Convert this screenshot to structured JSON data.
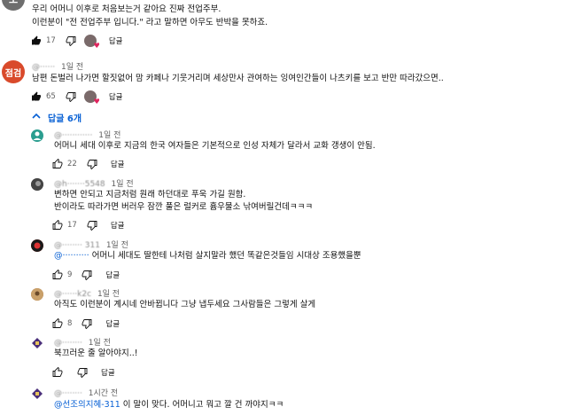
{
  "comments": [
    {
      "avatar_text": "모",
      "avatar_color": "#6e6e6e",
      "lines": [
        "우리 어머니 이후로 처음보는거 같아요 진짜 전업주부.",
        "이런분이 \"전 전업주부 입니다.\" 라고 말하면 아무도 반박을 못하죠."
      ],
      "likes": "17",
      "reply_label": "답글"
    },
    {
      "avatar_text": "점검",
      "avatar_color": "#d94a2b",
      "author": "@······",
      "time": "1일 전",
      "lines": [
        "남편 돈벌러 나가면 할짓없어 맘 카페나 기웃거리며 세상만사 관여하는 잉여인간들이 나츠키를 보고 반만 따라갔으면.."
      ],
      "likes": "65",
      "reply_label": "답글"
    }
  ],
  "replies_toggle": {
    "label": "답글 6개",
    "arrow": "^"
  },
  "replies": [
    {
      "avatar_color": "#2a9d8f",
      "author": "@············",
      "time": "1일 전",
      "lines": [
        "어머니 세대 이후로 지금의 한국 여자들은 기본적으로 인성 자체가 달라서 교화 갱생이 안됨."
      ],
      "likes": "22",
      "reply_label": "답글"
    },
    {
      "avatar_color": "#555555",
      "author": "@h·······5548",
      "time": "1일 전",
      "lines": [
        "변하면 안되고 지금처럼 원래 하던대로 푸욱 가길 원함.",
        "반이라도 따라가면 버러우 잠깐 풀은 럴커로 흄우물소 낚여버릴건데ㅋㅋㅋ"
      ],
      "likes": "17",
      "reply_label": "답글"
    },
    {
      "avatar_color": "#c0392b",
      "author": "@········ 311",
      "time": "1일 전",
      "mention": "@·········· ",
      "lines": [
        "어머니 세대도 딸한테 나처럼 살지말라 했던 똑같은것들임 시대상 조용했을뿐"
      ],
      "likes": "9",
      "reply_label": "답글"
    },
    {
      "avatar_color": "#b07a4a",
      "author": "@······k2c",
      "time": "1일 전",
      "lines": [
        "아직도 이런분이 계시네 안바뀝니다 그냥 냅두세요 그사람들은 그렇게 살게"
      ],
      "likes": "8",
      "reply_label": "답글"
    },
    {
      "avatar_color": "#4a2f7a",
      "author": "@········",
      "time": "1일 전",
      "lines": [
        "북끄러운 줄 알아야지..!"
      ],
      "likes": "",
      "reply_label": "답글"
    },
    {
      "avatar_color": "#4a2f7a",
      "author": "@········",
      "time": "1시간 전",
      "mention": "@선조의지혜-311",
      "lines": [
        " 이 말이 맞다. 어머니고 뭐고 깔 건 까야지ㅋㅋ"
      ],
      "likes": "",
      "reply_label": ""
    }
  ]
}
